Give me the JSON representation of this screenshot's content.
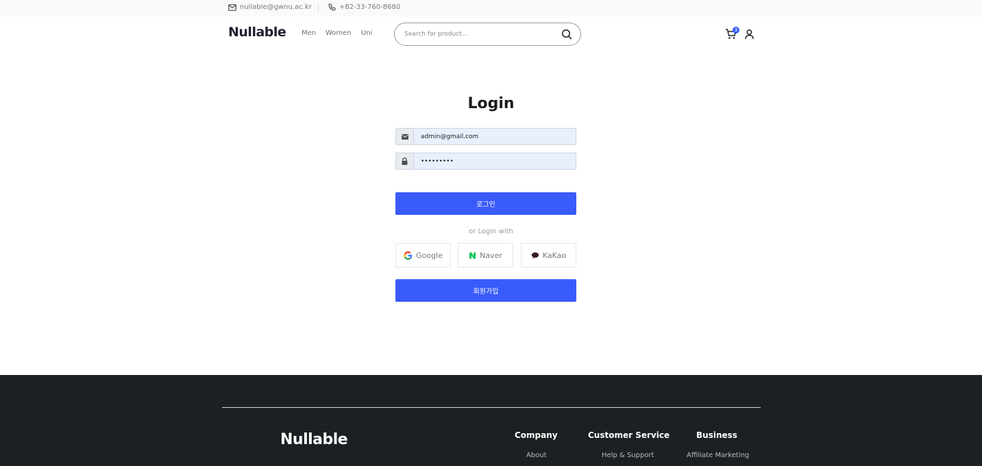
{
  "topbar": {
    "email": "nullable@gwnu.ac.kr",
    "phone": "+82-33-760-8680"
  },
  "header": {
    "logo": "Nullable",
    "nav": [
      "Men",
      "Women",
      "Uni"
    ],
    "search_placeholder": "Search for product...",
    "cart_count": "3"
  },
  "login": {
    "title": "Login",
    "email_value": "admin@gmail.com",
    "password_value": "password1",
    "login_button": "로그인",
    "or_text": "or Login with",
    "social": [
      "Google",
      "Naver",
      "KaKao"
    ],
    "signup_button": "회원가입"
  },
  "footer": {
    "logo": "Nullable",
    "columns": [
      {
        "title": "Company",
        "link": "About"
      },
      {
        "title": "Customer Service",
        "link": "Help & Support"
      },
      {
        "title": "Business",
        "link": "Affiliate Marketing"
      }
    ]
  },
  "colors": {
    "accent": "#3a5bfb",
    "footer_bg": "#1b2123",
    "input_bg": "#e8f0fe"
  }
}
